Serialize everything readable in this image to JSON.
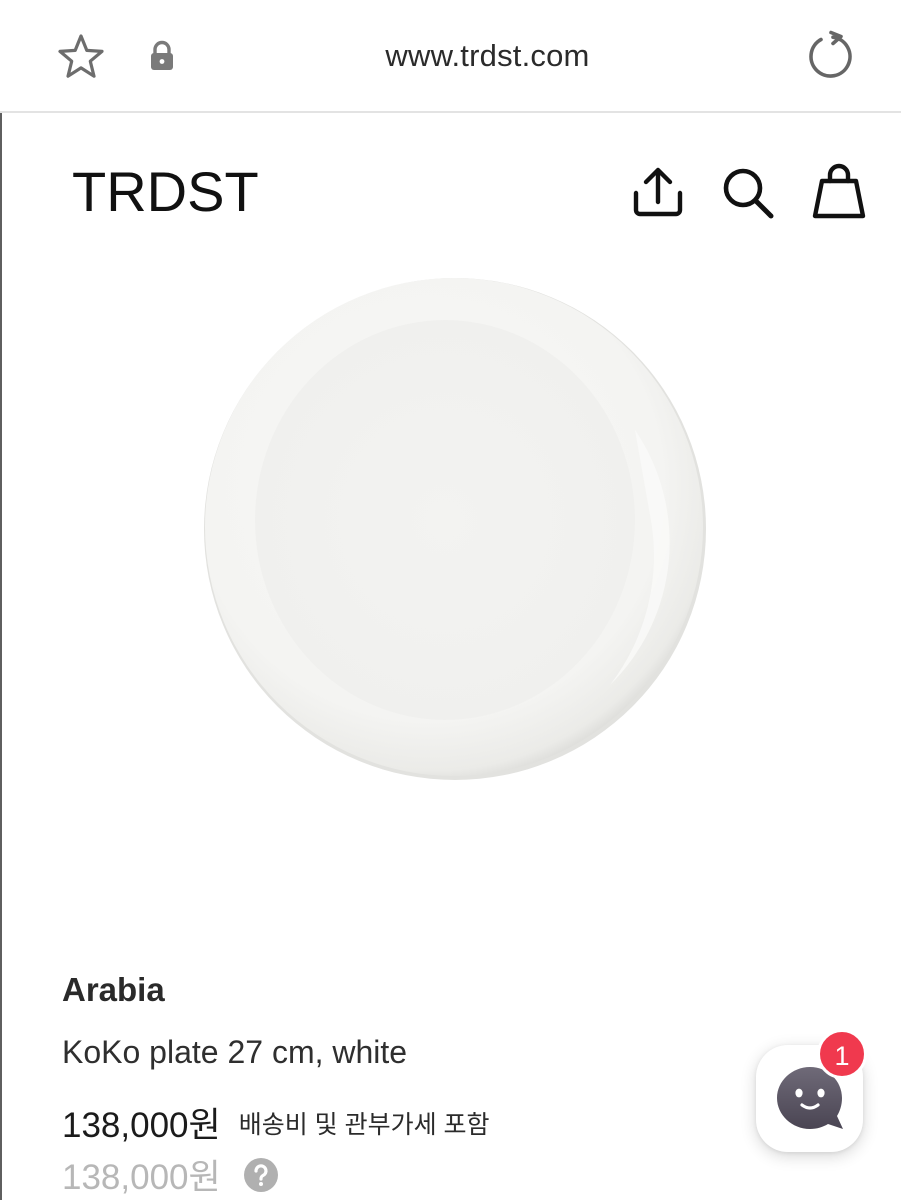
{
  "browser": {
    "url": "www.trdst.com"
  },
  "header": {
    "brand_logo": "TRDST",
    "icons": [
      "share-icon",
      "search-icon",
      "shopping-bag-icon"
    ]
  },
  "product": {
    "image_icon": "white-plate-photo",
    "brand": "Arabia",
    "name": "KoKo plate 27 cm, white",
    "price": "138,000원",
    "price_note": "배송비 및 관부가세 포함",
    "original_price": "138,000원"
  },
  "chat": {
    "badge_count": "1"
  },
  "colors": {
    "badge": "#f0394e",
    "chat_icon": "#5b5566",
    "original_price": "#b7b7b7"
  }
}
